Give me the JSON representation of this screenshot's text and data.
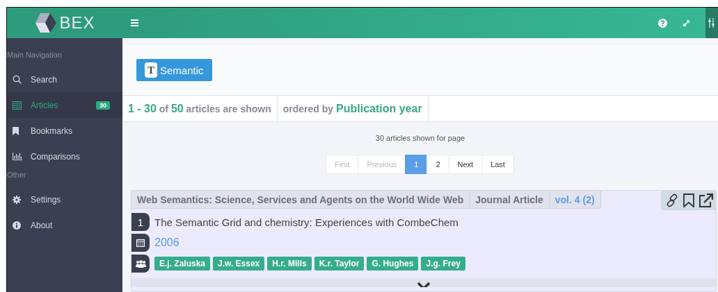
{
  "header": {
    "logo": "BEX"
  },
  "sidebar": {
    "sections": [
      {
        "title": "Main Navigation",
        "items": [
          {
            "kind": "search",
            "label": "Search",
            "selected": false
          },
          {
            "kind": "articles",
            "label": "Articles",
            "selected": true,
            "badge": "30"
          },
          {
            "kind": "bookmarks",
            "label": "Bookmarks",
            "selected": false
          },
          {
            "kind": "comparisons",
            "label": "Comparisons",
            "selected": false
          }
        ]
      },
      {
        "title": "Other",
        "items": [
          {
            "kind": "settings",
            "label": "Settings",
            "selected": false
          },
          {
            "kind": "about",
            "label": "About",
            "selected": false
          }
        ]
      }
    ]
  },
  "semantic_button": {
    "letter": "T",
    "label": "Semantic"
  },
  "summary": {
    "count": "**1 - 30** of **50** articles are shown",
    "order": "ordered by **Publication year**"
  },
  "per_page_note": "30 articles shown for page",
  "pagination": [
    {
      "label": "First",
      "selected": false,
      "disabled": true
    },
    {
      "label": "Previous",
      "selected": false,
      "disabled": true
    },
    {
      "label": "1",
      "selected": true,
      "disabled": false
    },
    {
      "label": "2",
      "selected": false,
      "disabled": false
    },
    {
      "label": "Next",
      "selected": false,
      "disabled": false
    },
    {
      "label": "Last",
      "selected": false,
      "disabled": false
    }
  ],
  "article": {
    "journal": "Web Semantics: Science, Services and Agents on the World Wide Web",
    "type": "Journal Article",
    "volume": "vol. 4 (2)",
    "number": "1",
    "title": "The Semantic Grid and chemistry: Experiences with CombeChem",
    "year": "2006",
    "authors": [
      "E.j. Zaluska",
      "J.w. Essex",
      "H.r. Mills",
      "K.r. Taylor",
      "G. Hughes",
      "J.g. Frey"
    ]
  }
}
